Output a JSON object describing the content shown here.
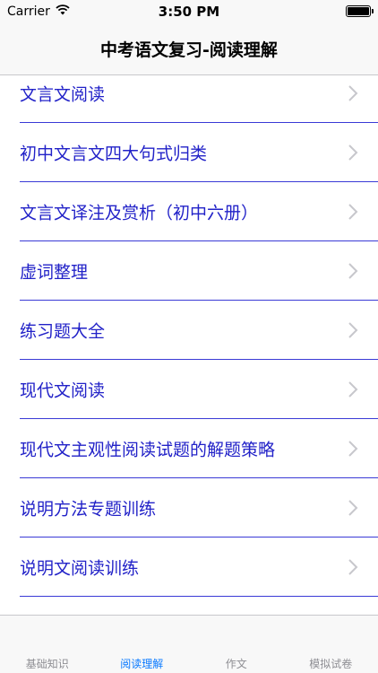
{
  "status_bar": {
    "carrier": "Carrier",
    "time": "3:50 PM",
    "battery_level": 1.0
  },
  "nav": {
    "title": "中考语文复习-阅读理解"
  },
  "list": {
    "items": [
      {
        "label": "文言文阅读"
      },
      {
        "label": "初中文言文四大句式归类"
      },
      {
        "label": "文言文译注及赏析（初中六册）"
      },
      {
        "label": "虚词整理"
      },
      {
        "label": "练习题大全"
      },
      {
        "label": "现代文阅读"
      },
      {
        "label": "现代文主观性阅读试题的解题策略"
      },
      {
        "label": "说明方法专题训练"
      },
      {
        "label": "说明文阅读训练"
      }
    ]
  },
  "tab_bar": {
    "tabs": [
      {
        "label": "基础知识",
        "active": false
      },
      {
        "label": "阅读理解",
        "active": true
      },
      {
        "label": "作文",
        "active": false
      },
      {
        "label": "模拟试卷",
        "active": false
      }
    ]
  },
  "colors": {
    "item_text": "#2222c8",
    "separator": "#3a3ad6",
    "active_tab": "#0a7aff",
    "inactive_tab": "#8e8e93"
  }
}
